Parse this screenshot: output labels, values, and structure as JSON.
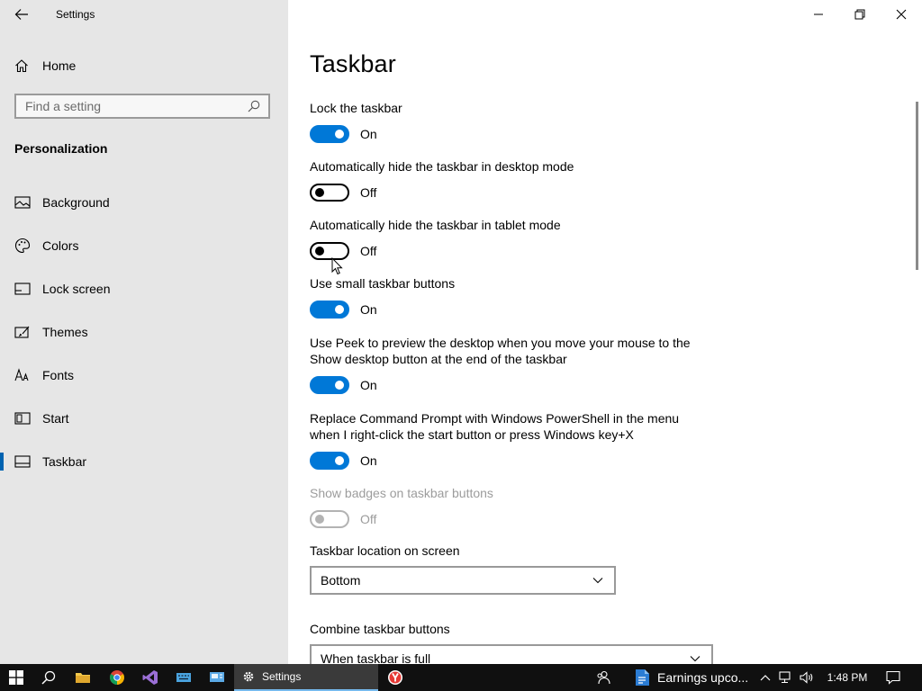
{
  "window": {
    "title": "Settings"
  },
  "sidebar": {
    "home_label": "Home",
    "search_placeholder": "Find a setting",
    "section_title": "Personalization",
    "items": [
      {
        "label": "Background",
        "icon": "picture-icon",
        "active": false
      },
      {
        "label": "Colors",
        "icon": "palette-icon",
        "active": false
      },
      {
        "label": "Lock screen",
        "icon": "lock-screen-icon",
        "active": false
      },
      {
        "label": "Themes",
        "icon": "themes-icon",
        "active": false
      },
      {
        "label": "Fonts",
        "icon": "font-icon",
        "active": false
      },
      {
        "label": "Start",
        "icon": "start-icon",
        "active": false
      },
      {
        "label": "Taskbar",
        "icon": "taskbar-icon",
        "active": true
      }
    ]
  },
  "main": {
    "title": "Taskbar",
    "settings": [
      {
        "label": "Lock the taskbar",
        "state": "On",
        "on": true,
        "disabled": false
      },
      {
        "label": "Automatically hide the taskbar in desktop mode",
        "state": "Off",
        "on": false,
        "disabled": false
      },
      {
        "label": "Automatically hide the taskbar in tablet mode",
        "state": "Off",
        "on": false,
        "disabled": false
      },
      {
        "label": "Use small taskbar buttons",
        "state": "On",
        "on": true,
        "disabled": false
      },
      {
        "label_lines": [
          "Use Peek to preview the desktop when you move your mouse to the",
          "Show desktop button at the end of the taskbar"
        ],
        "state": "On",
        "on": true,
        "disabled": false
      },
      {
        "label_lines": [
          "Replace Command Prompt with Windows PowerShell in the menu",
          "when I right-click the start button or press Windows key+X"
        ],
        "state": "On",
        "on": true,
        "disabled": false
      },
      {
        "label": "Show badges on taskbar buttons",
        "state": "Off",
        "on": false,
        "disabled": true
      }
    ],
    "location": {
      "label": "Taskbar location on screen",
      "value": "Bottom"
    },
    "combine": {
      "label": "Combine taskbar buttons",
      "value": "When taskbar is full"
    }
  },
  "taskbar": {
    "settings_label": "Settings",
    "earnings_label": "Earnings upco...",
    "clock": "1:48 PM"
  }
}
